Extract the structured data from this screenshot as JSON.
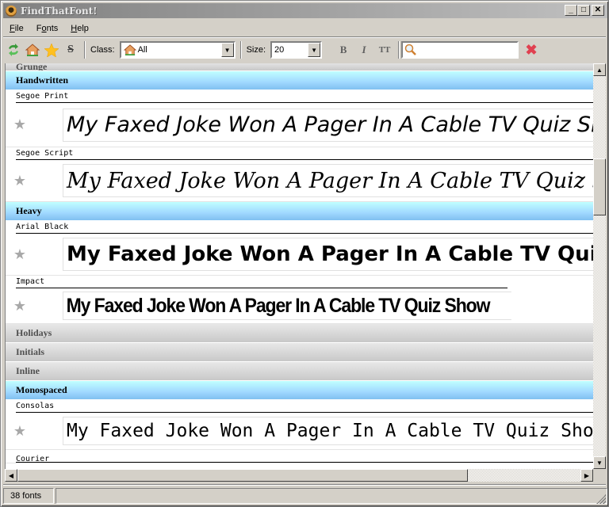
{
  "window": {
    "title": "FindThatFont!",
    "controls": {
      "minimize": "_",
      "maximize": "□",
      "close": "✕"
    }
  },
  "menu": [
    {
      "label": "File",
      "accel": "F"
    },
    {
      "label": "Fonts",
      "accel": "o"
    },
    {
      "label": "Help",
      "accel": "H"
    }
  ],
  "toolbar": {
    "icons": [
      "refresh-icon",
      "home-icon",
      "favorites-star-icon",
      "strikethrough-icon"
    ],
    "class_label": "Class:",
    "class_value": "All",
    "size_label": "Size:",
    "size_value": "20",
    "bold_label": "B",
    "italic_label": "I",
    "caps_label": "TT",
    "search_value": "",
    "clear_symbol": "✖"
  },
  "sample_text": "My Faxed Joke Won A Pager In A Cable TV Quiz Show",
  "list": {
    "partial_top_category": "Grunge",
    "categories": [
      {
        "name": "Handwritten",
        "open": true,
        "fonts": [
          {
            "name": "Segoe Print",
            "style": "segoe-print"
          },
          {
            "name": "Segoe Script",
            "style": "segoe-script"
          }
        ]
      },
      {
        "name": "Heavy",
        "open": true,
        "fonts": [
          {
            "name": "Arial Black",
            "style": "arial-black"
          },
          {
            "name": "Impact",
            "style": "impact"
          }
        ]
      },
      {
        "name": "Holidays",
        "open": false
      },
      {
        "name": "Initials",
        "open": false
      },
      {
        "name": "Inline",
        "open": false
      },
      {
        "name": "Monospaced",
        "open": true,
        "fonts": [
          {
            "name": "Consolas",
            "style": "consolas"
          },
          {
            "name": "Courier",
            "style": "courier"
          }
        ]
      }
    ]
  },
  "status": {
    "font_count": "38 fonts"
  }
}
